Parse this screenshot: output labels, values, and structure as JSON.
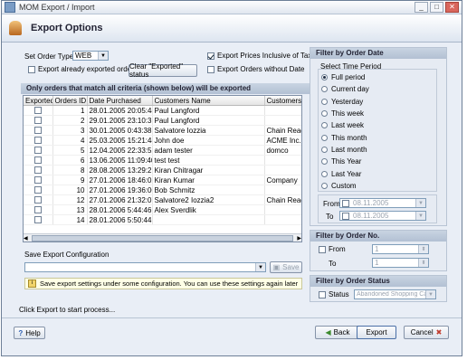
{
  "window": {
    "title": "MOM Export / Import"
  },
  "header": {
    "title": "Export Options"
  },
  "order_type": {
    "label": "Set Order Type",
    "value": "WEB"
  },
  "checkboxes": {
    "export_already": {
      "label": "Export already exported orders",
      "checked": false
    },
    "prices_incl_tax": {
      "label": "Export Prices Inclusive of Tax",
      "checked": true
    },
    "without_date": {
      "label": "Export Orders without Date",
      "checked": false
    }
  },
  "clear_button": "Clear \"Exported\" status",
  "grid": {
    "caption": "Only orders that match all criteria (shown below) will be exported",
    "columns": [
      "Exported",
      "Orders ID",
      "Date Purchased",
      "Customers Name",
      "Customers"
    ],
    "rows": [
      {
        "exported": false,
        "id": "1",
        "date": "28.01.2005 20:05:44",
        "name": "Paul Langford",
        "company": ""
      },
      {
        "exported": false,
        "id": "2",
        "date": "29.01.2005 23:10:31",
        "name": "Paul Langford",
        "company": ""
      },
      {
        "exported": false,
        "id": "3",
        "date": "30.01.2005 0:43:38",
        "name": "Salvatore Iozzia",
        "company": "Chain Reac"
      },
      {
        "exported": false,
        "id": "4",
        "date": "25.03.2005 15:21:44",
        "name": "John doe",
        "company": "ACME Inc."
      },
      {
        "exported": false,
        "id": "5",
        "date": "12.04.2005 22:33:52",
        "name": "adam tester",
        "company": "domco"
      },
      {
        "exported": false,
        "id": "6",
        "date": "13.06.2005 11:09:40",
        "name": "test test",
        "company": ""
      },
      {
        "exported": false,
        "id": "8",
        "date": "28.08.2005 13:29:21",
        "name": "Kiran Chitragar",
        "company": ""
      },
      {
        "exported": false,
        "id": "9",
        "date": "27.01.2006 18:46:02",
        "name": "Kiran Kumar",
        "company": "Company"
      },
      {
        "exported": false,
        "id": "10",
        "date": "27.01.2006 19:36:00",
        "name": "Bob Schmitz",
        "company": ""
      },
      {
        "exported": false,
        "id": "12",
        "date": "27.01.2006 21:32:07",
        "name": "Salvatore2 Iozzia2",
        "company": "Chain Reac"
      },
      {
        "exported": false,
        "id": "13",
        "date": "28.01.2006 5:44:46",
        "name": "Alex Sverdlik",
        "company": ""
      },
      {
        "exported": false,
        "id": "14",
        "date": "28.01.2006 5:50:44",
        "name": "",
        "company": ""
      }
    ]
  },
  "save_config": {
    "label": "Save Export Configuration",
    "value": "",
    "button": "Save"
  },
  "info_text": "Save export settings under some configuration. You can use these settings again later",
  "status_text": "Click Export to start process...",
  "filter_date": {
    "title": "Filter by Order Date",
    "group_label": "Select Time Period",
    "options": [
      "Full period",
      "Current day",
      "Yesterday",
      "This week",
      "Last week",
      "This month",
      "Last month",
      "This Year",
      "Last Year",
      "Custom"
    ],
    "selected": "Full period",
    "from_label": "From",
    "from_value": "08.11.2005",
    "to_label": "To",
    "to_value": "08.11.2005"
  },
  "filter_order_no": {
    "title": "Filter by Order No.",
    "from_label": "From",
    "from_value": "1",
    "to_label": "To",
    "to_value": "1"
  },
  "filter_status": {
    "title": "Filter by Order Status",
    "status_label": "Status",
    "status_value": "Abandoned Shopping Cart"
  },
  "footer": {
    "help": "Help",
    "back": "Back",
    "export": "Export",
    "cancel": "Cancel"
  }
}
